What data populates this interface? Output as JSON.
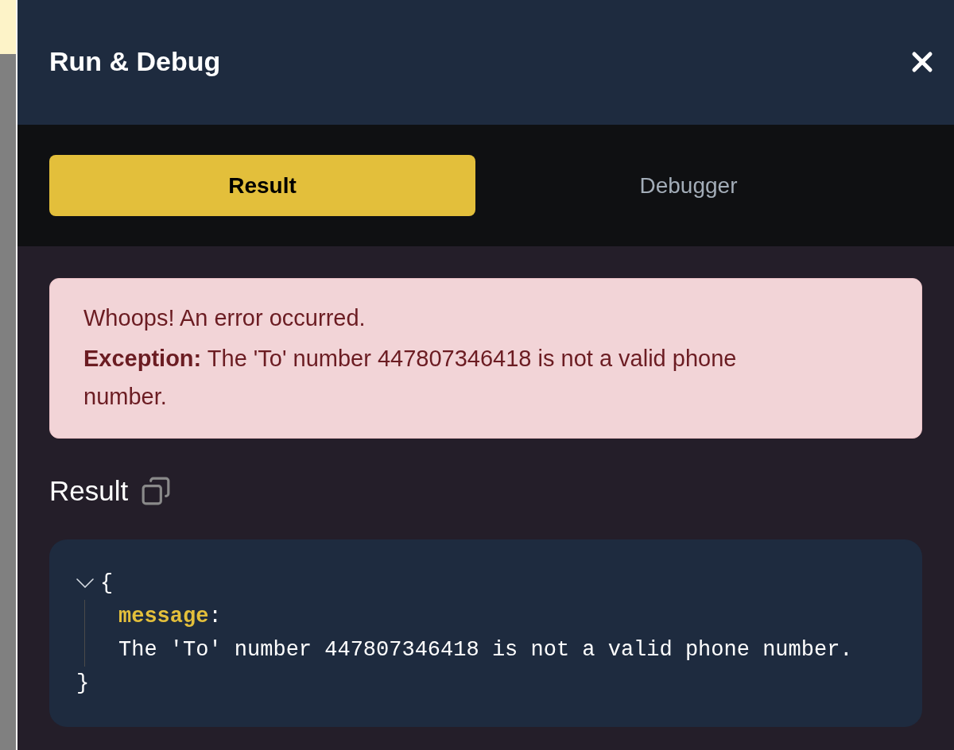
{
  "panel": {
    "title": "Run & Debug"
  },
  "tabs": [
    {
      "label": "Result",
      "selected": true
    },
    {
      "label": "Debugger",
      "selected": false
    }
  ],
  "error": {
    "heading": "Whoops! An error occurred.",
    "detail": "**Exception:** The 'To' number 447807346418 is not a valid phone number."
  },
  "result": {
    "heading": "Result",
    "tree": {
      "expanded": true,
      "open_brace": "{",
      "close_brace": "}",
      "entries": [
        {
          "key": "message",
          "separator": ":",
          "value": "The 'To' number 447807346418 is not a valid phone number."
        }
      ]
    }
  }
}
